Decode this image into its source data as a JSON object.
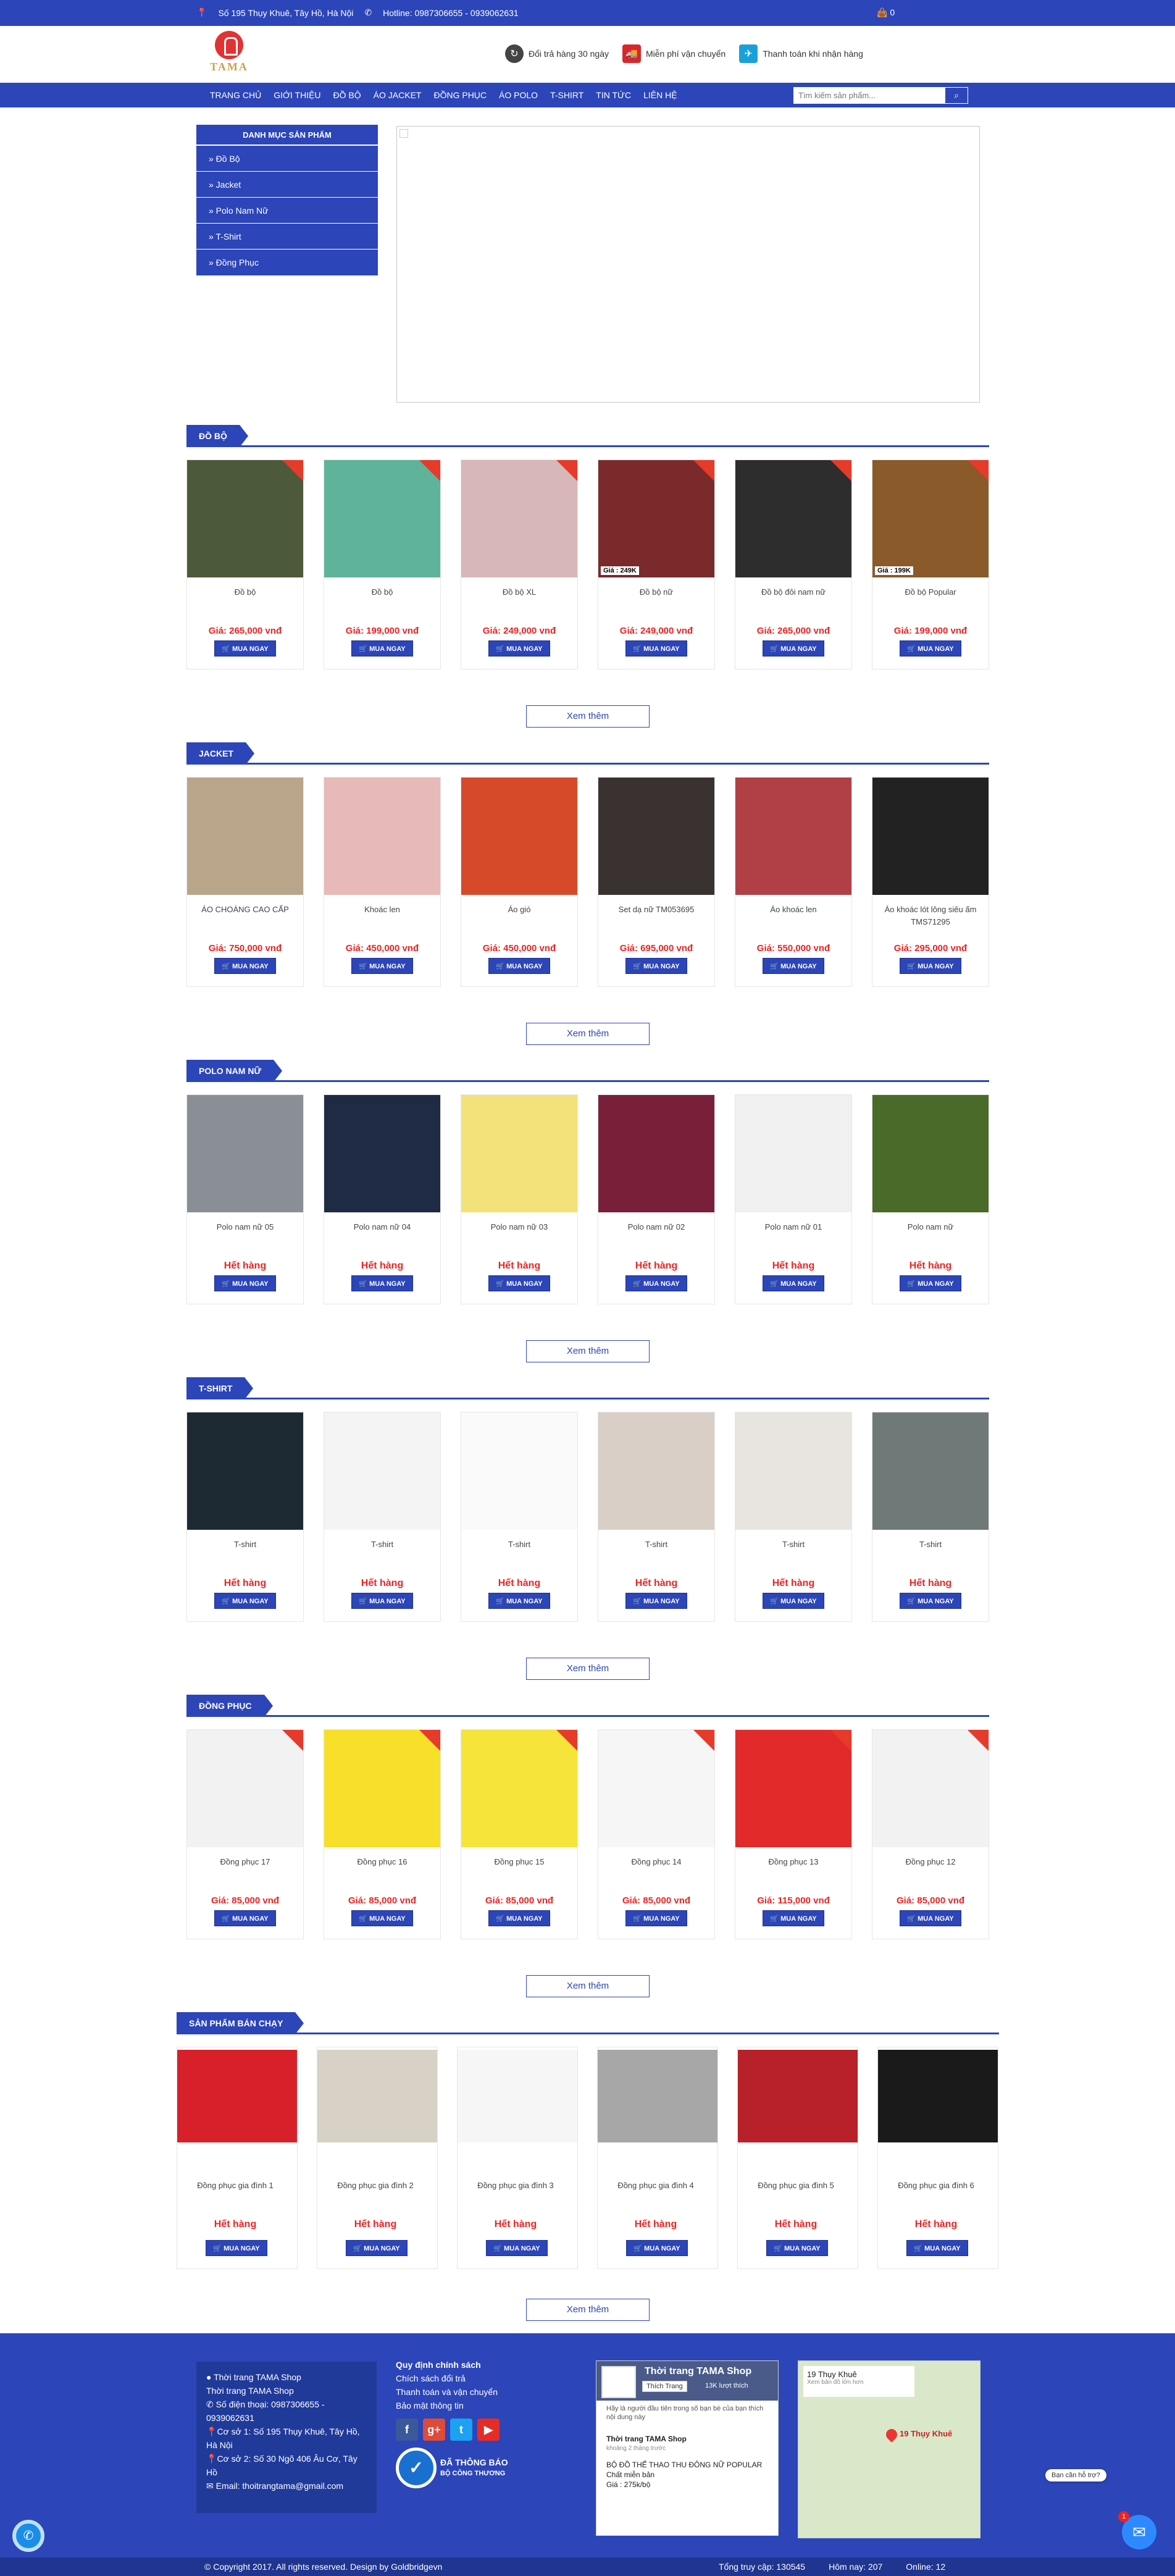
{
  "topbar": {
    "address": "Số 195 Thụy Khuê, Tây Hồ, Hà Nội",
    "hotline": "Hotline: 0987306655 - 0939062631",
    "cart_count": "0"
  },
  "header": {
    "logo_text": "TAMA",
    "promos": [
      "Đổi trả hàng 30 ngày",
      "Miễn phí vận chuyển",
      "Thanh toán khi nhận hàng"
    ]
  },
  "nav": {
    "items": [
      "TRANG CHỦ",
      "GIỚI THIỆU",
      "ĐỒ BỘ",
      "ÁO JACKET",
      "ĐỒNG PHỤC",
      "ÁO POLO",
      "T-SHIRT",
      "TIN TỨC",
      "LIÊN HỆ"
    ],
    "search_placeholder": "Tìm kiếm sản phẩm..."
  },
  "categories": {
    "title": "DANH MỤC SẢN PHẨM",
    "items": [
      "» Đồ Bộ",
      "» Jacket",
      "» Polo Nam Nữ",
      "» T-Shirt",
      "» Đồng Phục"
    ]
  },
  "more_label": "Xem thêm",
  "buy_label": "MUA NGAY",
  "sections": [
    {
      "title": "ĐỒ BỘ",
      "products": [
        {
          "name": "Đồ bộ",
          "price": "Giá: 265,000 vnđ",
          "color": "#4c5a3a",
          "tag": ""
        },
        {
          "name": "Đồ bộ",
          "price": "Giá: 199,000 vnđ",
          "color": "#5fb39a",
          "tag": ""
        },
        {
          "name": "Đồ bộ XL",
          "price": "Giá: 249,000 vnđ",
          "color": "#d8b7b8",
          "tag": ""
        },
        {
          "name": "Đồ bộ nữ",
          "price": "Giá: 249,000 vnđ",
          "color": "#7a2a2a",
          "tag": "Giá : 249K"
        },
        {
          "name": "Đồ bộ đôi nam nữ",
          "price": "Giá: 265,000 vnđ",
          "color": "#2d2d2d",
          "tag": ""
        },
        {
          "name": "Đồ bộ Popular",
          "price": "Giá: 199,000 vnđ",
          "color": "#8a5a2a",
          "tag": "Giá : 199K"
        }
      ]
    },
    {
      "title": "JACKET",
      "products": [
        {
          "name": "ÁO CHOÀNG CAO CẤP",
          "price": "Giá: 750,000 vnđ",
          "color": "#b9a68a",
          "tag": ""
        },
        {
          "name": "Khoác len",
          "price": "Giá: 450,000 vnđ",
          "color": "#e7b9b8",
          "tag": ""
        },
        {
          "name": "Áo gió",
          "price": "Giá: 450,000 vnđ",
          "color": "#d64a2a",
          "tag": ""
        },
        {
          "name": "Set dạ nữ TM053695",
          "price": "Giá: 695,000 vnđ",
          "color": "#3a3230",
          "tag": ""
        },
        {
          "name": "Áo khoác len",
          "price": "Giá: 550,000 vnđ",
          "color": "#b04046",
          "tag": ""
        },
        {
          "name": "Áo khoác lót lông siêu ấm TMS71295",
          "price": "Giá: 295,000 vnđ",
          "color": "#222222",
          "tag": ""
        }
      ]
    },
    {
      "title": "POLO NAM NỮ",
      "products": [
        {
          "name": "Polo nam nữ 05",
          "price": "Hết hàng",
          "color": "#8a8f96",
          "tag": ""
        },
        {
          "name": "Polo nam nữ 04",
          "price": "Hết hàng",
          "color": "#1f2a44",
          "tag": ""
        },
        {
          "name": "Polo nam nữ 03",
          "price": "Hết hàng",
          "color": "#f3e27a",
          "tag": ""
        },
        {
          "name": "Polo nam nữ 02",
          "price": "Hết hàng",
          "color": "#7a1f3a",
          "tag": ""
        },
        {
          "name": "Polo nam nữ 01",
          "price": "Hết hàng",
          "color": "#f0f0f0",
          "tag": ""
        },
        {
          "name": "Polo nam nữ",
          "price": "Hết hàng",
          "color": "#4a6a2a",
          "tag": ""
        }
      ]
    },
    {
      "title": "T-SHIRT",
      "products": [
        {
          "name": "T-shirt",
          "price": "Hết hàng",
          "color": "#1e2a33",
          "tag": ""
        },
        {
          "name": "T-shirt",
          "price": "Hết hàng",
          "color": "#f4f4f4",
          "tag": ""
        },
        {
          "name": "T-shirt",
          "price": "Hết hàng",
          "color": "#fafafa",
          "tag": ""
        },
        {
          "name": "T-shirt",
          "price": "Hết hàng",
          "color": "#d9cfc6",
          "tag": ""
        },
        {
          "name": "T-shirt",
          "price": "Hết hàng",
          "color": "#e8e4e0",
          "tag": ""
        },
        {
          "name": "T-shirt",
          "price": "Hết hàng",
          "color": "#6f7a78",
          "tag": ""
        }
      ]
    },
    {
      "title": "ĐỒNG PHỤC",
      "products": [
        {
          "name": "Đồng phục 17",
          "price": "Giá: 85,000 vnđ",
          "color": "#f2f2f2",
          "tag": ""
        },
        {
          "name": "Đồng phục 16",
          "price": "Giá: 85,000 vnđ",
          "color": "#f7df2a",
          "tag": ""
        },
        {
          "name": "Đồng phục 15",
          "price": "Giá: 85,000 vnđ",
          "color": "#f7e43a",
          "tag": ""
        },
        {
          "name": "Đồng phục 14",
          "price": "Giá: 85,000 vnđ",
          "color": "#f6f6f6",
          "tag": ""
        },
        {
          "name": "Đồng phục 13",
          "price": "Giá: 115,000 vnđ",
          "color": "#e22a2a",
          "tag": ""
        },
        {
          "name": "Đồng phục 12",
          "price": "Giá: 85,000 vnđ",
          "color": "#f2f2f2",
          "tag": ""
        }
      ]
    },
    {
      "title": "SẢN PHẨM BÁN CHẠY",
      "products": [
        {
          "name": "Đồng phục gia đình 1",
          "price": "Hết hàng",
          "color": "#d8202a",
          "tag": ""
        },
        {
          "name": "Đồng phục gia đình 2",
          "price": "Hết hàng",
          "color": "#d8d2c6",
          "tag": ""
        },
        {
          "name": "Đồng phục gia đình 3",
          "price": "Hết hàng",
          "color": "#f6f6f6",
          "tag": ""
        },
        {
          "name": "Đồng phục gia đình 4",
          "price": "Hết hàng",
          "color": "#a7a7a7",
          "tag": ""
        },
        {
          "name": "Đồng phục gia đình 5",
          "price": "Hết hàng",
          "color": "#b8202a",
          "tag": ""
        },
        {
          "name": "Đồng phục gia đình 6",
          "price": "Hết hàng",
          "color": "#1a1a1a",
          "tag": ""
        }
      ]
    }
  ],
  "footer": {
    "info": [
      "Thời trang TAMA Shop",
      "Thời trang TAMA Shop",
      "Số điện thoại: 0987306655 - 0939062631",
      "Cơ sở 1: Số 195 Thụy Khuê, Tây Hồ, Hà Nội",
      "Cơ sở 2: Số 30 Ngõ 406 Âu Cơ, Tây Hồ",
      "Email: thoitrangtama@gmail.com"
    ],
    "policy_title": "Quy định chính sách",
    "policies": [
      "Chích sách đổi trả",
      "Thanh toán và vận chuyển",
      "Bảo mật thông tin"
    ],
    "badge_text": "ĐÃ THÔNG BÁO",
    "badge_sub": "BỘ CÔNG THƯƠNG",
    "fb_page": "Thời trang TAMA Shop",
    "fb_like": "Thích Trang",
    "fb_count": "13K lượt thích",
    "fb_desc": "Hãy là người đầu tiên trong số bạn bè của bạn thích nội dung này",
    "fb_post_author": "Thời trang TAMA Shop",
    "fb_post_time": "khoảng 2 tháng trước",
    "fb_post": "BỘ ĐỒ THỂ THAO THU ĐÔNG NỮ POPULAR",
    "fb_post2": "Chất miễn bản",
    "fb_post3": "Giá : 275k/bộ",
    "map_title": "19 Thụy Khuê",
    "map_sub": "Xem bản đồ lớn hơn",
    "map_pin": "19 Thụy Khuê"
  },
  "bottom": {
    "copyright": "© Copyright 2017. All rights reserved. Design by Goldbridgevn",
    "total": "Tổng truy cập: 130545",
    "today": "Hôm nay: 207",
    "online": "Online: 12"
  },
  "chat_label": "Bạn cần hỗ trợ?",
  "messenger_count": "1",
  "colors": {
    "primary": "#2c45b8",
    "price": "#e22222"
  }
}
